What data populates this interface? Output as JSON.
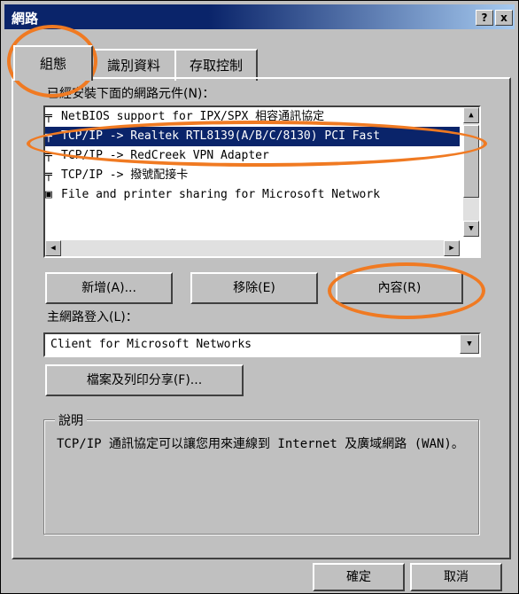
{
  "window": {
    "title": "網路",
    "help_button": "?",
    "close_button": "x"
  },
  "tabs": [
    {
      "label": "組態"
    },
    {
      "label": "識別資料"
    },
    {
      "label": "存取控制"
    }
  ],
  "components": {
    "label": "已經安裝下面的網路元件(N)：",
    "items": [
      {
        "text": "NetBIOS support for IPX/SPX 相容通訊協定",
        "selected": false
      },
      {
        "text": "TCP/IP -> Realtek RTL8139(A/B/C/8130) PCI Fast",
        "selected": true
      },
      {
        "text": "TCP/IP -> RedCreek VPN Adapter",
        "selected": false
      },
      {
        "text": "TCP/IP -> 撥號配接卡",
        "selected": false
      },
      {
        "text": "File and printer sharing for Microsoft Network",
        "selected": false
      }
    ]
  },
  "buttons": {
    "add": "新增(A)...",
    "remove": "移除(E)",
    "properties": "內容(R)",
    "file_print_sharing": "檔案及列印分享(F)...",
    "ok": "確定",
    "cancel": "取消"
  },
  "logon": {
    "label": "主網路登入(L)：",
    "value": "Client for Microsoft Networks"
  },
  "description": {
    "title": "說明",
    "text": "TCP/IP 通訊協定可以讓您用來連線到 Internet 及廣域網路 (WAN)。"
  },
  "colors": {
    "highlight": "#0a246a",
    "annotation": "#f07a22"
  }
}
